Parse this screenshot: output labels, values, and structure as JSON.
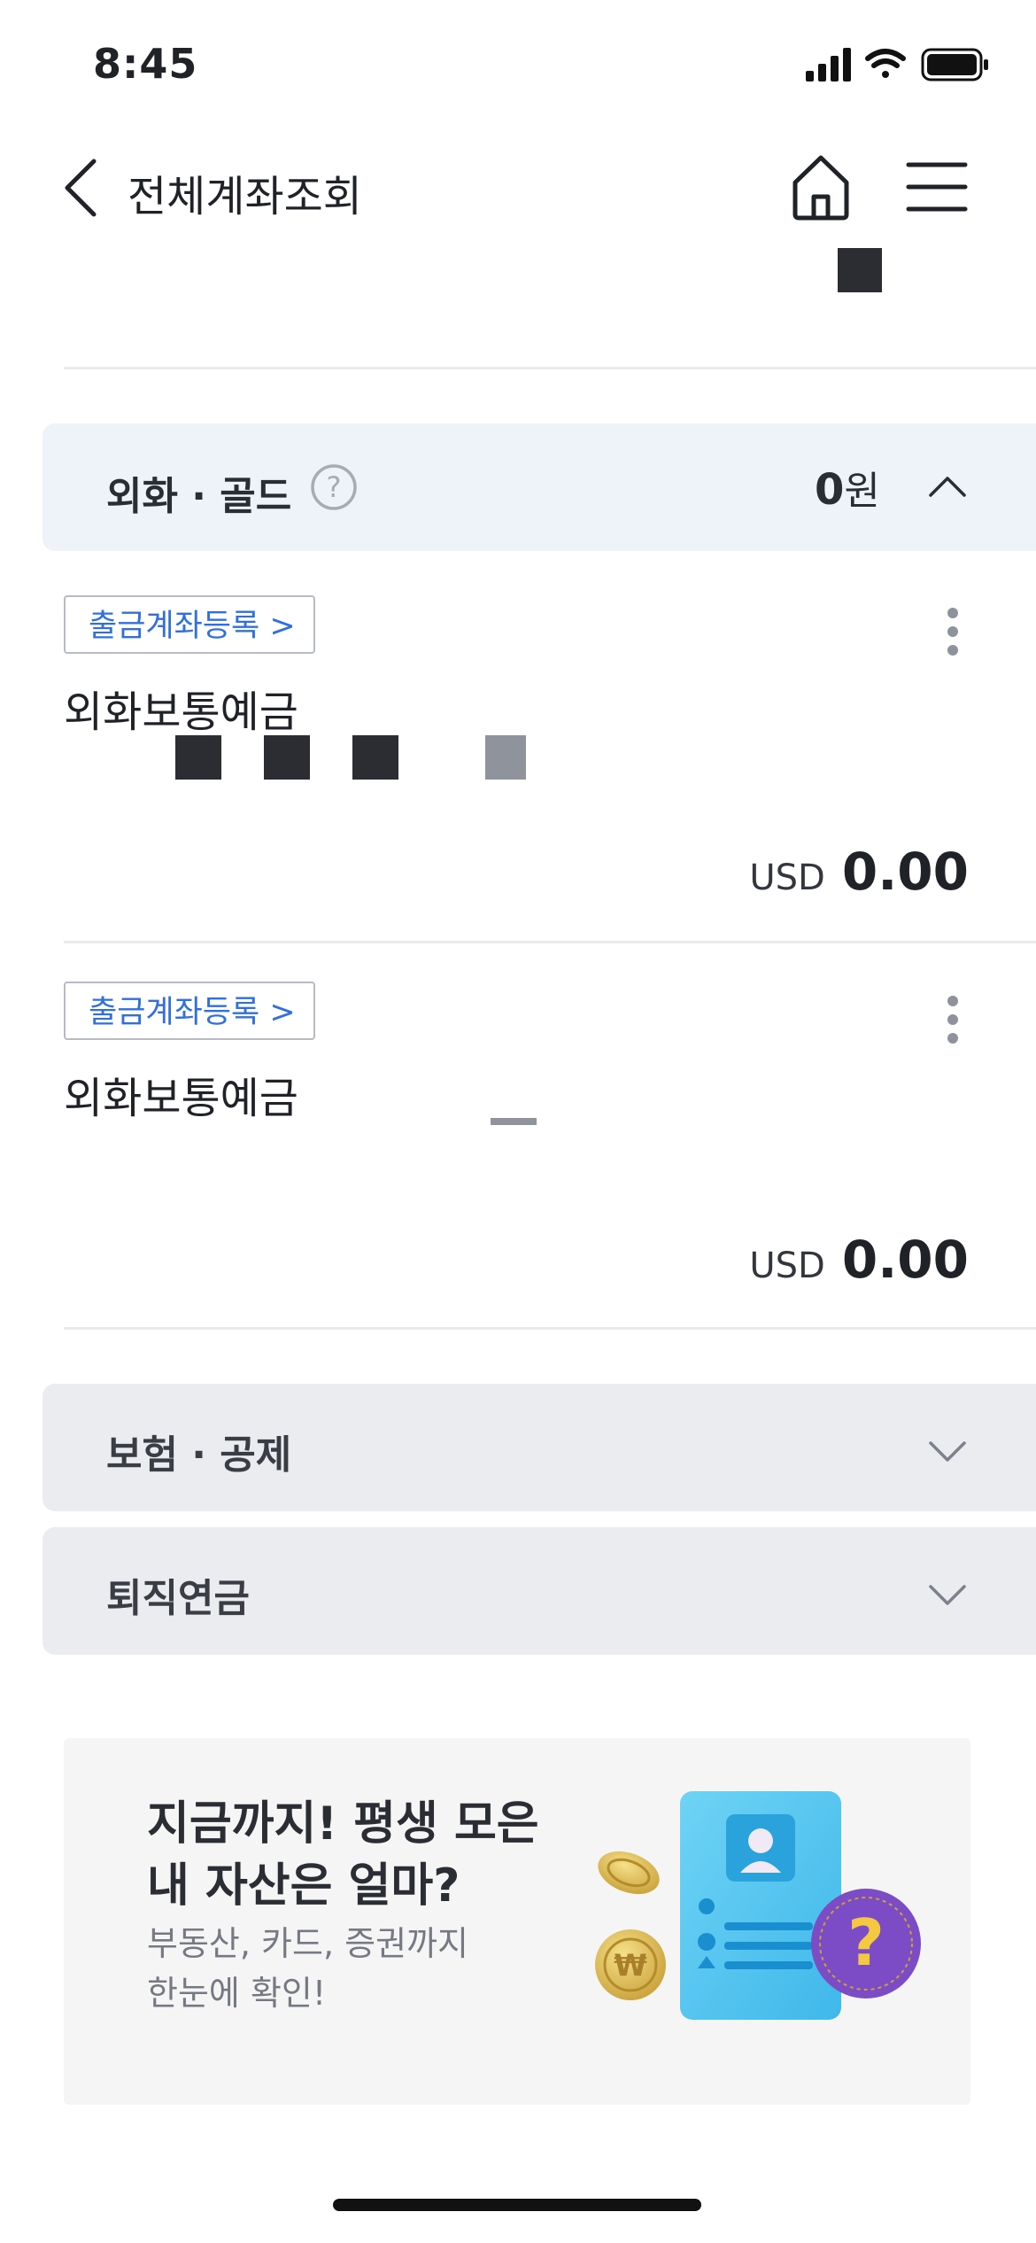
{
  "status_bar": {
    "time": "8:45"
  },
  "header": {
    "title": "전체계좌조회"
  },
  "sections": {
    "fx_gold": {
      "title": "외화 · 골드",
      "total_amount": "0",
      "total_unit": "원"
    },
    "insurance": {
      "title": "보험 · 공제"
    },
    "pension": {
      "title": "퇴직연금"
    }
  },
  "accounts": [
    {
      "register_label": "출금계좌등록 >",
      "name": "외화보통예금",
      "currency": "USD",
      "balance": "0.00"
    },
    {
      "register_label": "출금계좌등록 >",
      "name": "외화보통예금",
      "currency": "USD",
      "balance": "0.00"
    }
  ],
  "promo": {
    "title_line1": "지금까지! 평생 모은",
    "title_line2": "내 자산은 얼마?",
    "sub_line1": "부동산, 카드, 증권까지",
    "sub_line2": "한눈에 확인!"
  },
  "colors": {
    "accent_blue": "#2f6fe0",
    "section_fx_bg": "#eef3fa",
    "section_bg": "#eaecef",
    "coin_purple": "#7b4cc6"
  }
}
